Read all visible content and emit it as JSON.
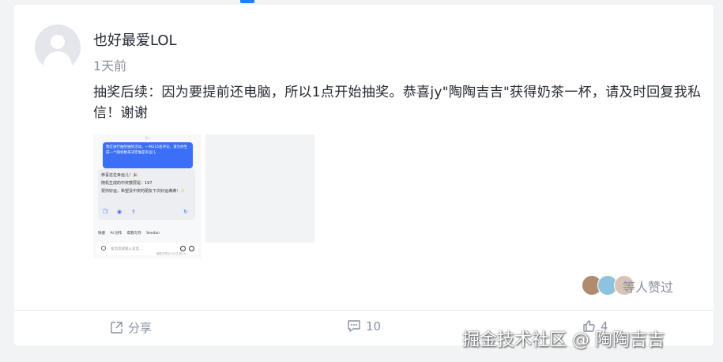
{
  "post": {
    "username": "也好最爱LOL",
    "time": "1天前",
    "content": "抽奖后续：因为要提前还电脑，所以1点开始抽奖。恭喜jy\"陶陶吉吉\"获得奶茶一杯，请及时回复我私信！谢谢"
  },
  "screenshot": {
    "top_label": "Qin",
    "bubble_text": "我在进行抽奖抽奖活动，一共215名评论，请为你生成一个随机数来决定谁是幸运儿",
    "reply_lines": [
      "恭喜这位幸运儿！🎉",
      "随机生成的中奖楼层是：197",
      "祝你好运，希望没中奖的朋友下次好运满满！✨"
    ],
    "tools": [
      "快捷",
      "AI 创作",
      "帮我写作",
      "Seedan"
    ],
    "input_placeholder": "发消息或输入说话...",
    "caption": "截取并导出今天生成LOL"
  },
  "likes": {
    "text": "等人赞过"
  },
  "actions": {
    "share_label": "分享",
    "comment_count": "10",
    "like_count": "4"
  },
  "watermark": "掘金技术社区 @ 陶陶吉吉",
  "colors": {
    "accent": "#1e80ff",
    "text": "#252933",
    "muted": "#8a919f"
  }
}
